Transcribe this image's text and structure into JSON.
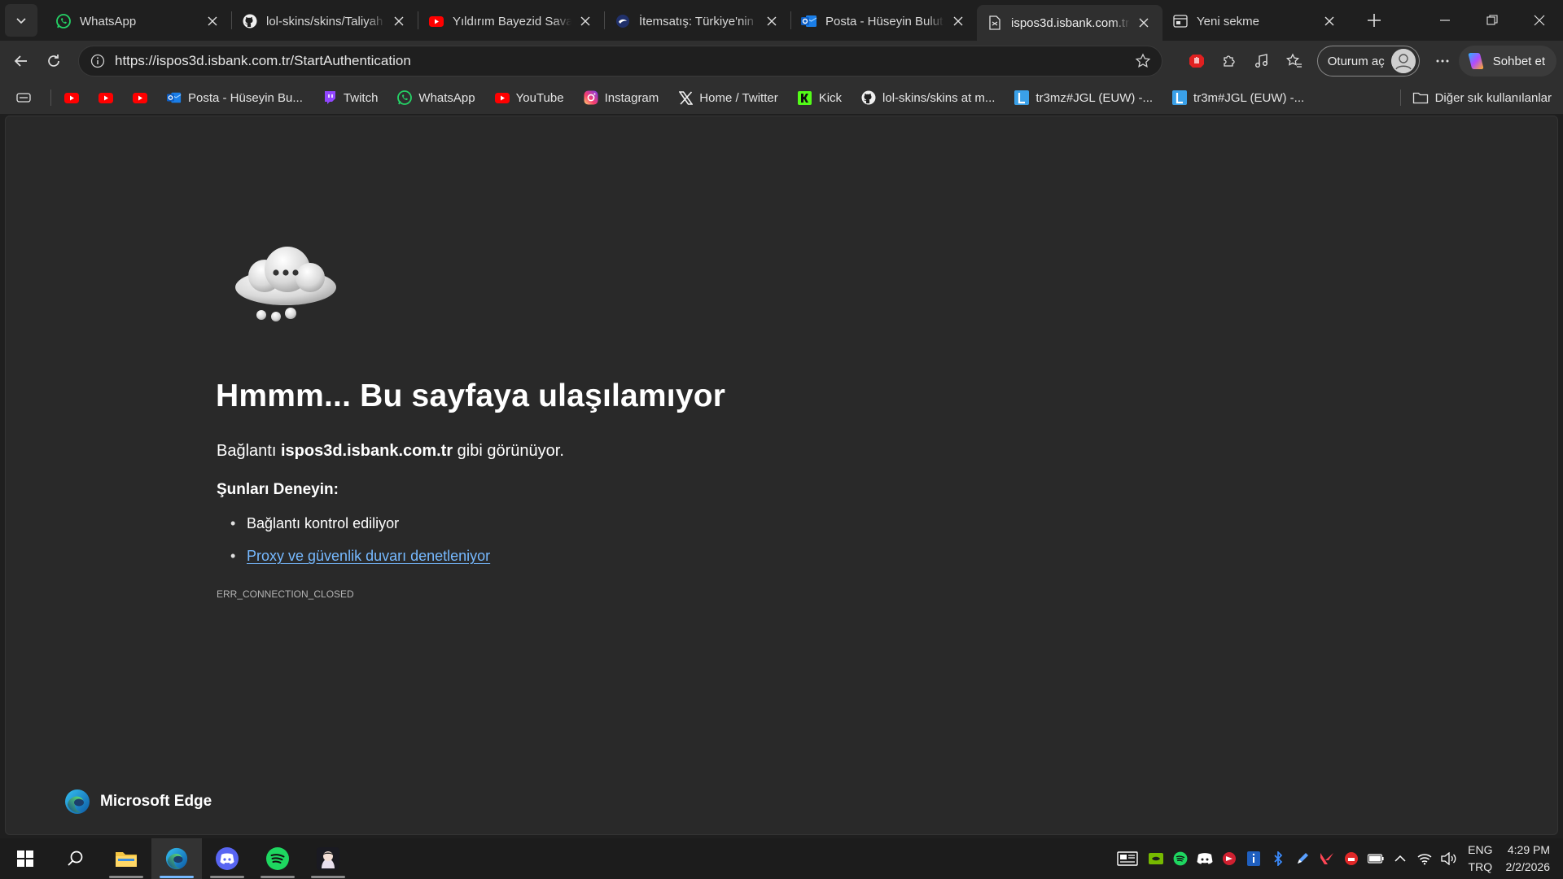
{
  "browser": {
    "tabs": [
      {
        "title": "WhatsApp",
        "favicon": "whatsapp-icon",
        "active": false
      },
      {
        "title": "lol-skins/skins/Taliyah at",
        "favicon": "github-icon",
        "active": false
      },
      {
        "title": "Yıldırım Bayezid Savaşla",
        "favicon": "youtube-icon",
        "active": false
      },
      {
        "title": "İtemsatış: Türkiye'nin En",
        "favicon": "itemsatis-icon",
        "active": false
      },
      {
        "title": "Posta - Hüseyin Bulut - (",
        "favicon": "outlook-icon",
        "active": false
      },
      {
        "title": "ispos3d.isbank.com.tr",
        "favicon": "broken-page-icon",
        "active": true
      },
      {
        "title": "Yeni sekme",
        "favicon": "new-tab-page-icon",
        "active": false
      }
    ],
    "url": "https://ispos3d.isbank.com.tr/StartAuthentication",
    "signin_label": "Oturum aç",
    "copilot_label": "Sohbet et"
  },
  "bookmarks": {
    "items": [
      {
        "label": "",
        "icon": "youtube-icon"
      },
      {
        "label": "",
        "icon": "youtube-icon"
      },
      {
        "label": "",
        "icon": "youtube-icon"
      },
      {
        "label": "Posta - Hüseyin Bu...",
        "icon": "outlook-icon"
      },
      {
        "label": "Twitch",
        "icon": "twitch-icon"
      },
      {
        "label": "WhatsApp",
        "icon": "whatsapp-icon"
      },
      {
        "label": "YouTube",
        "icon": "youtube-icon"
      },
      {
        "label": "Instagram",
        "icon": "instagram-icon"
      },
      {
        "label": "Home / Twitter",
        "icon": "x-icon"
      },
      {
        "label": "Kick",
        "icon": "kick-icon"
      },
      {
        "label": "lol-skins/skins at m...",
        "icon": "github-icon"
      },
      {
        "label": "tr3mz#JGL (EUW) -...",
        "icon": "l-letter-icon"
      },
      {
        "label": "tr3m#JGL (EUW) -...",
        "icon": "l-letter-icon"
      }
    ],
    "other_label": "Diğer sık kullanılanlar"
  },
  "error_page": {
    "title": "Hmmm... Bu sayfaya ulaşılamıyor",
    "message_prefix": "Bağlantı ",
    "message_host": "ispos3d.isbank.com.tr",
    "message_suffix": " gibi görünüyor.",
    "try_heading": "Şunları Deneyin:",
    "suggestions": [
      {
        "text": "Bağlantı kontrol ediliyor",
        "link": false
      },
      {
        "text": "Proxy ve güvenlik duvarı denetleniyor",
        "link": true
      }
    ],
    "error_code": "ERR_CONNECTION_CLOSED",
    "brand": "Microsoft Edge"
  },
  "taskbar": {
    "apps": [
      "windows-start-icon",
      "search-icon",
      "file-explorer-icon",
      "edge-icon",
      "discord-icon",
      "spotify-icon",
      "anime-app-icon"
    ],
    "tray_icons": [
      "news-icon",
      "nvidia-icon",
      "spotify-icon",
      "discord-icon",
      "tray-app-icon",
      "info-icon",
      "bluetooth-icon",
      "pen-icon",
      "valorant-icon",
      "red-app-icon",
      "battery-icon",
      "chevron-up-icon",
      "wifi-icon",
      "volume-icon"
    ],
    "lang_top": "ENG",
    "lang_bottom": "TRQ",
    "time": "4:29 PM",
    "date": "2/2/2026"
  },
  "colors": {
    "accent_link": "#76b9ff",
    "page_bg": "#292929",
    "chrome_bg": "#2f2f2f"
  }
}
